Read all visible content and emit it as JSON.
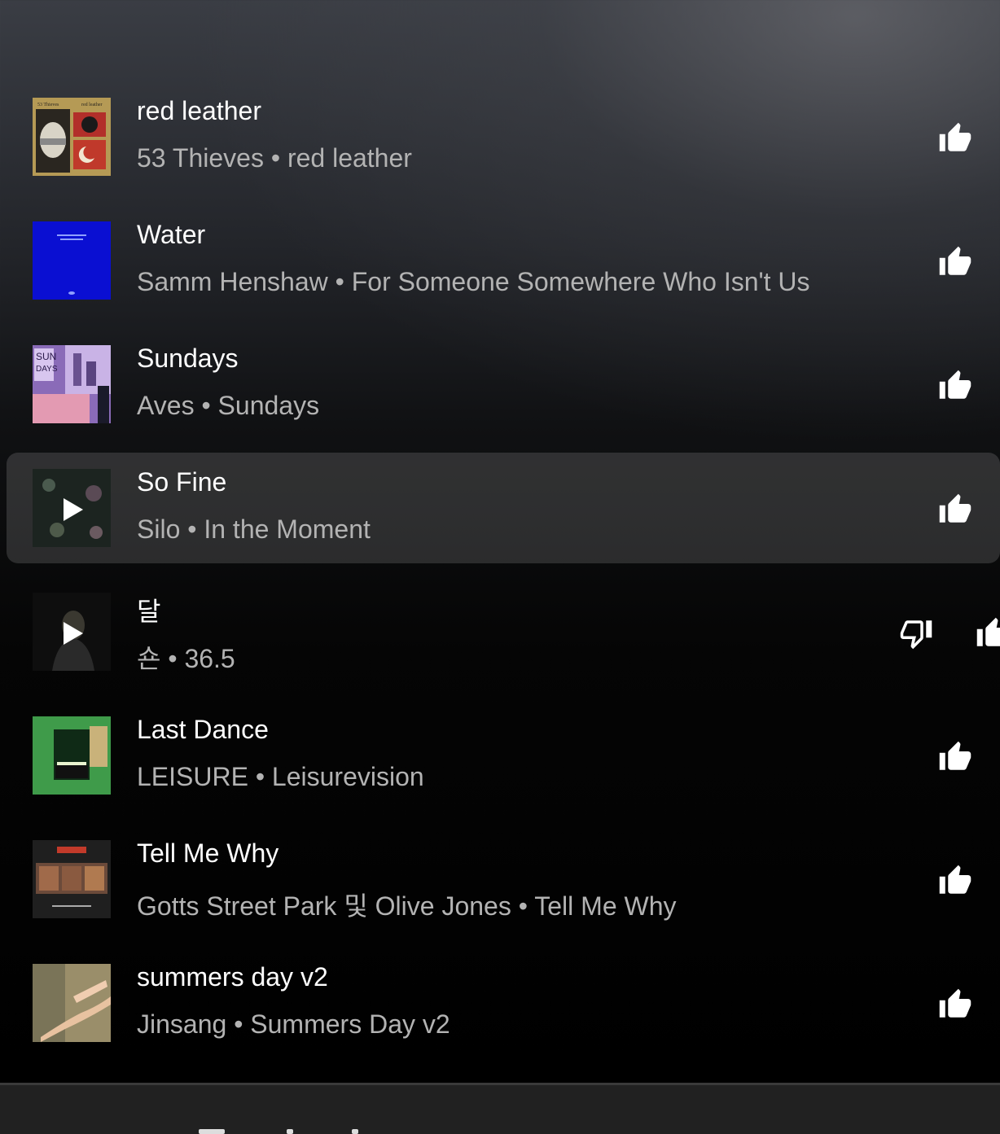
{
  "queue": [
    {
      "title": "red leather",
      "artist": "53 Thieves",
      "album": "red leather"
    },
    {
      "title": "Water",
      "artist": "Samm Henshaw",
      "album": "For Someone Somewhere Who Isn't Us"
    },
    {
      "title": "Sundays",
      "artist": "Aves",
      "album": "Sundays"
    },
    {
      "title": "So Fine",
      "artist": "Silo",
      "album": "In the Moment"
    },
    {
      "title": "달",
      "artist": "숀",
      "album": "36.5"
    },
    {
      "title": "Last Dance",
      "artist": "LEISURE",
      "album": "Leisurevision"
    },
    {
      "title": "Tell Me Why",
      "artist": "Gotts Street Park 및 Olive Jones",
      "album": "Tell Me Why"
    },
    {
      "title": "summers day v2",
      "artist": "Jinsang",
      "album": "Summers Day v2"
    }
  ],
  "separator": " • ",
  "icons": {
    "like": "thumb-up-icon",
    "dislike": "thumb-down-icon",
    "play": "play-icon"
  },
  "colors": {
    "subtitle": "#b3b3b3",
    "active_row": "rgba(255,255,255,0.14)"
  }
}
